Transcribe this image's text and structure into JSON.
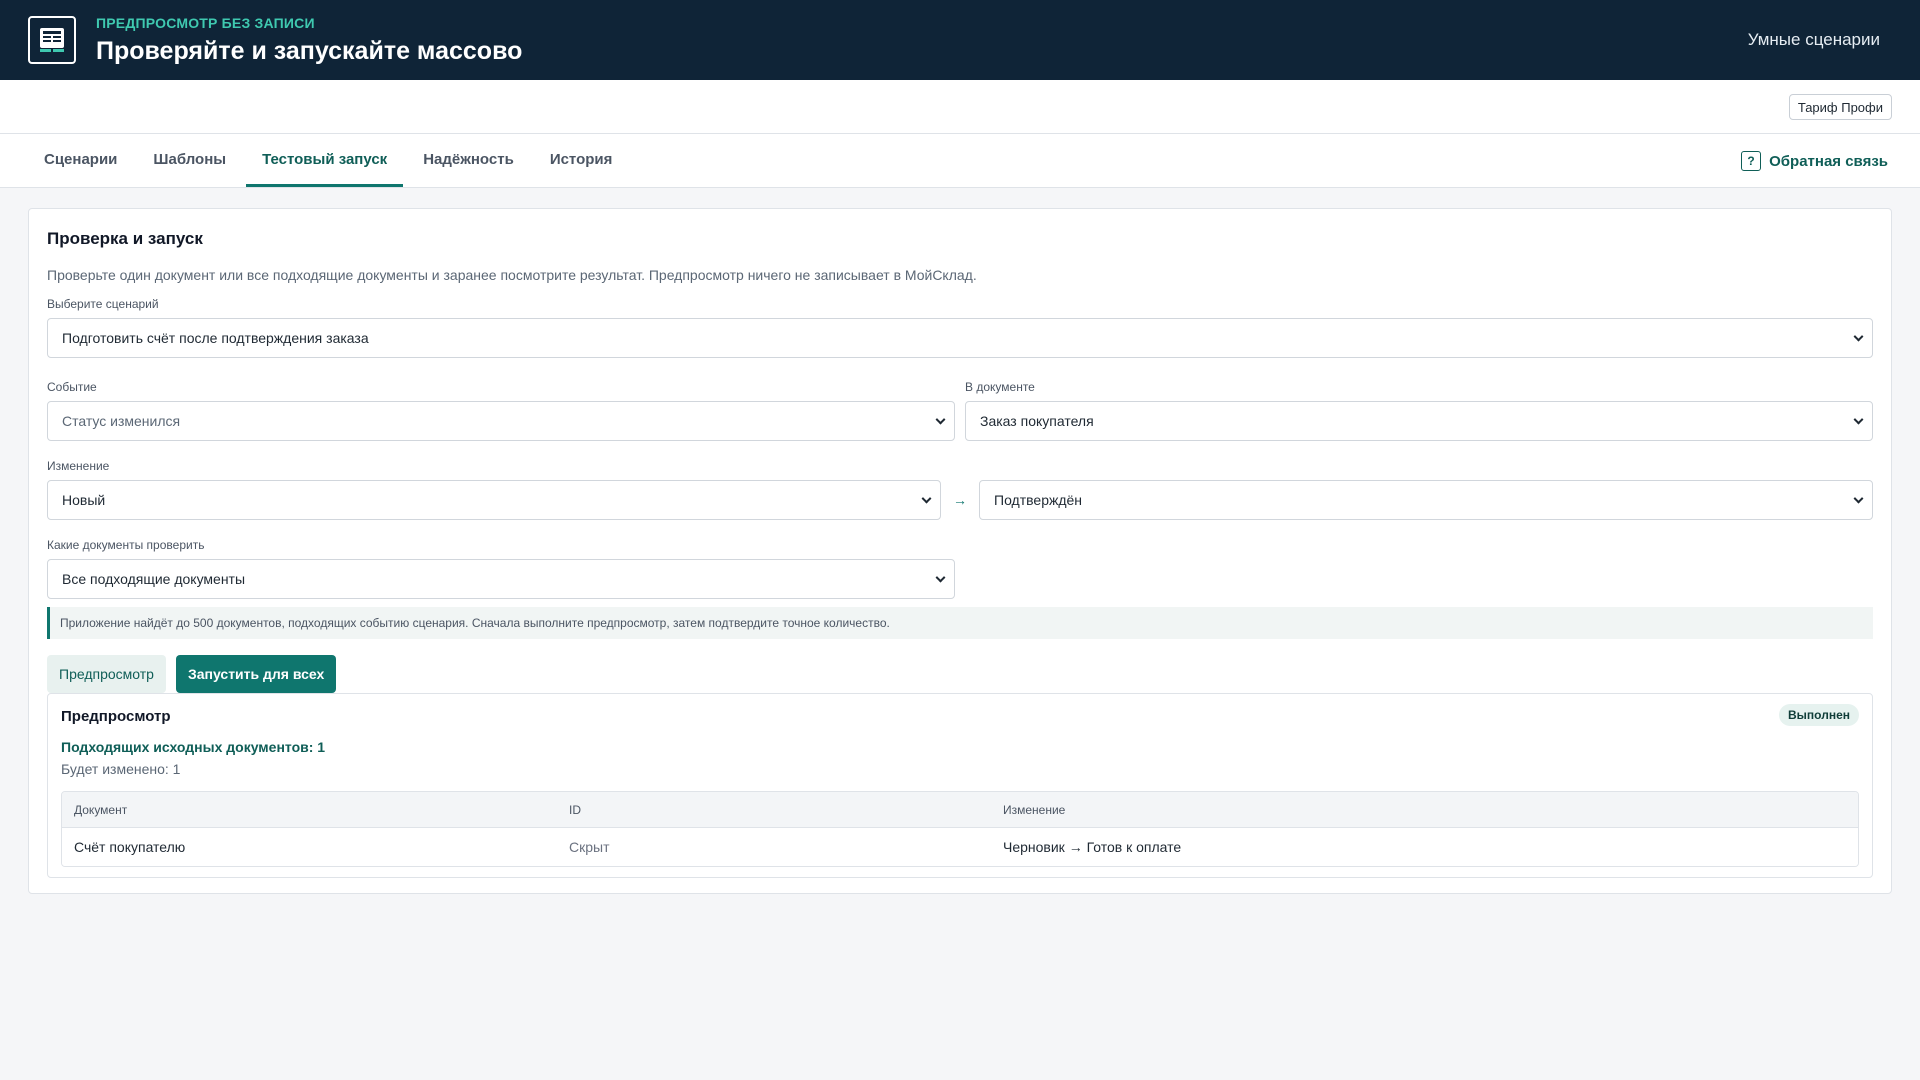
{
  "header": {
    "eyebrow": "ПРЕДПРОСМОТР БЕЗ ЗАПИСИ",
    "title": "Проверяйте и запускайте массово",
    "right_label": "Умные сценарии",
    "logo_icon": "document-app-icon"
  },
  "subbar": {
    "plan_label": "Тариф Профи"
  },
  "tabs": [
    {
      "label": "Сценарии",
      "active": false
    },
    {
      "label": "Шаблоны",
      "active": false
    },
    {
      "label": "Тестовый запуск",
      "active": true
    },
    {
      "label": "Надёжность",
      "active": false
    },
    {
      "label": "История",
      "active": false
    }
  ],
  "feedback": {
    "label": "Обратная связь",
    "icon": "help-icon",
    "icon_glyph": "?"
  },
  "card": {
    "title": "Проверка и запуск",
    "description": "Проверьте один документ или все подходящие документы и заранее посмотрите результат. Предпросмотр ничего не записывает в МойСклад.",
    "scenario": {
      "label": "Выберите сценарий",
      "value": "Подготовить счёт после подтверждения заказа"
    },
    "event": {
      "label": "Событие",
      "value": "Статус изменился"
    },
    "document": {
      "label": "В документе",
      "value": "Заказ покупателя"
    },
    "change": {
      "label": "Изменение",
      "from": "Новый",
      "arrow": "→",
      "to": "Подтверждён"
    },
    "docs_to_check": {
      "label": "Какие документы проверить",
      "value": "Все подходящие документы"
    },
    "info_text": "Приложение найдёт до 500 документов, подходящих событию сценария. Сначала выполните предпросмотр, затем подтвердите точное количество.",
    "buttons": {
      "preview": "Предпросмотр",
      "run_all": "Запустить для всех"
    },
    "preview": {
      "title": "Предпросмотр",
      "status": "Выполнен",
      "match_count": "Подходящих исходных документов: 1",
      "changed_count": "Будет изменено: 1",
      "table": {
        "columns": [
          "Документ",
          "ID",
          "Изменение"
        ],
        "rows": [
          [
            "Счёт покупателю",
            "Скрыт",
            "Черновик → Готов к оплате"
          ]
        ]
      }
    }
  },
  "colors": {
    "header_bg": "#0f2437",
    "accent": "#0f766e",
    "eyebrow": "#3fc9b0"
  }
}
